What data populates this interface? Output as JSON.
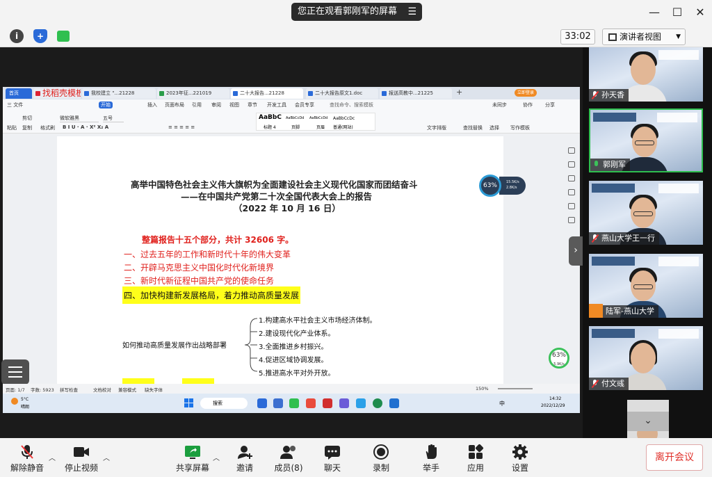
{
  "window": {
    "banner_text": "您正在观看郭刚军的屏幕",
    "banner_menu_icon": "menu-icon",
    "controls": [
      "minimize-icon",
      "maximize-icon",
      "close-icon"
    ]
  },
  "topbar": {
    "timer": "33:02",
    "view_label": "演讲者视图",
    "icons": [
      "info-icon",
      "shield-icon",
      "signal-bars-icon"
    ]
  },
  "wps": {
    "tabs": [
      {
        "label": "首页"
      },
      {
        "label": "找稻壳模板"
      },
      {
        "label": "我校建立 \"...21228"
      },
      {
        "label": "2023年征...221019"
      },
      {
        "label": "二十大报告...21228"
      },
      {
        "label": "二十大报告原文1.doc"
      },
      {
        "label": "报送高教中...21225"
      }
    ],
    "login_label": "立即登录",
    "menu": [
      "三 文件",
      "开始",
      "插入",
      "页面布局",
      "引用",
      "审阅",
      "视图",
      "章节",
      "开发工具",
      "会员专享",
      "查找命令、搜索模板",
      "未同步",
      "协作",
      "分享"
    ],
    "ribbon": {
      "paste": "粘贴",
      "cut": "剪切",
      "copy": "复制",
      "format_painter": "格式刷",
      "font": "微软雅黑",
      "size": "五号",
      "styles": [
        {
          "preview": "AaBbC",
          "name": "标题 4"
        },
        {
          "preview": "AaBbCcDd",
          "name": "页脚"
        },
        {
          "preview": "AaBbCcDd",
          "name": "页眉"
        },
        {
          "preview": "AaBbCcDc",
          "name": "普通(网站)"
        }
      ],
      "text_layout": "文字排版",
      "find_replace": "查找替换",
      "select": "选择",
      "template": "写作模板"
    },
    "document": {
      "title_line1": "高举中国特色社会主义伟大旗帜为全面建设社会主义现代化国家而团结奋斗",
      "title_line2": "——在中国共产党第二十次全国代表大会上的报告",
      "title_line3": "（2022 年 10 月 16 日）",
      "summary": "整篇报告十五个部分，共计 32606 字。",
      "items": [
        "一、过去五年的工作和新时代十年的伟大变革",
        "二、开辟马克思主义中国化时代化新境界",
        "三、新时代新征程中国共产党的使命任务"
      ],
      "highlight_item": "四、加快构建新发展格局，着力推动高质量发展",
      "mindmap_center": "如何推动高质量发展作出战略部署",
      "mindmap_branches": [
        "1.构建高水平社会主义市场经济体制。",
        "2.建设现代化产业体系。",
        "3.全面推进乡村振兴。",
        "4.促进区域协调发展。",
        "5.推进高水平对外开放。"
      ]
    },
    "gauge_top": {
      "percent": "63%",
      "up": "15.5K/s",
      "down": "2.8K/s"
    },
    "gauge_bottom": {
      "percent": "63%",
      "rate": "5.9K/s"
    },
    "statusbar": {
      "page": "页面: 1/7",
      "words": "字数: 5923",
      "spell": "拼写检查",
      "proof": "文档校对",
      "compat": "兼容模式",
      "font_missing": "缺失字体",
      "zoom": "150%"
    },
    "taskbar": {
      "weather_temp": "5°C",
      "weather_desc": "晴朗",
      "search": "搜索",
      "ime": "中",
      "time": "14:32",
      "date": "2022/12/29"
    }
  },
  "participants": [
    {
      "name": "孙天香",
      "muted": true
    },
    {
      "name": "郭刚军",
      "muted": false,
      "active": true
    },
    {
      "name": "燕山大学王一行",
      "muted": true
    },
    {
      "name": "陆军-燕山大学",
      "muted": true
    },
    {
      "name": "付文彧",
      "muted": true
    }
  ],
  "toolbar": {
    "mute": "解除静音",
    "video": "停止视频",
    "share": "共享屏幕",
    "invite": "邀请",
    "members": "成员(8)",
    "chat": "聊天",
    "record": "录制",
    "raise_hand": "举手",
    "apps": "应用",
    "settings": "设置",
    "leave": "离开会议"
  },
  "colors": {
    "accent_green": "#2fbf4f",
    "leave_red": "#e0302a",
    "wps_blue": "#2a6ad8",
    "highlight": "#ffff1a"
  }
}
